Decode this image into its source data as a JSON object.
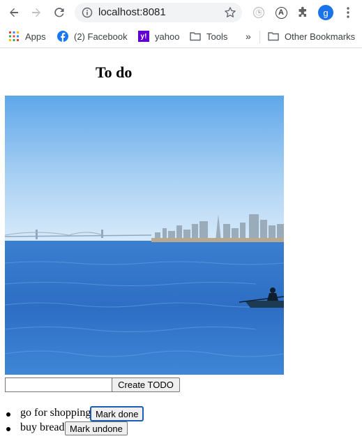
{
  "browser": {
    "url": "localhost:8081",
    "avatar_letter": "g",
    "extension_a_letter": "A",
    "bookmarks": [
      {
        "label": "Apps",
        "icon": "apps-grid-icon"
      },
      {
        "label": "(2) Facebook",
        "icon": "facebook-icon"
      },
      {
        "label": "yahoo",
        "icon": "yahoo-icon"
      },
      {
        "label": "Tools",
        "icon": "folder-icon"
      }
    ],
    "overflow_label": "»",
    "other_bookmarks": "Other Bookmarks"
  },
  "page": {
    "title": "To do",
    "input_value": "",
    "create_button": "Create TODO",
    "todos": [
      {
        "text": "go for shopping",
        "button": "Mark done"
      },
      {
        "text": "buy bread",
        "button": "Mark undone"
      }
    ]
  },
  "colors": {
    "accent": "#1a73e8",
    "focus_outline": "#1a5fb4"
  }
}
